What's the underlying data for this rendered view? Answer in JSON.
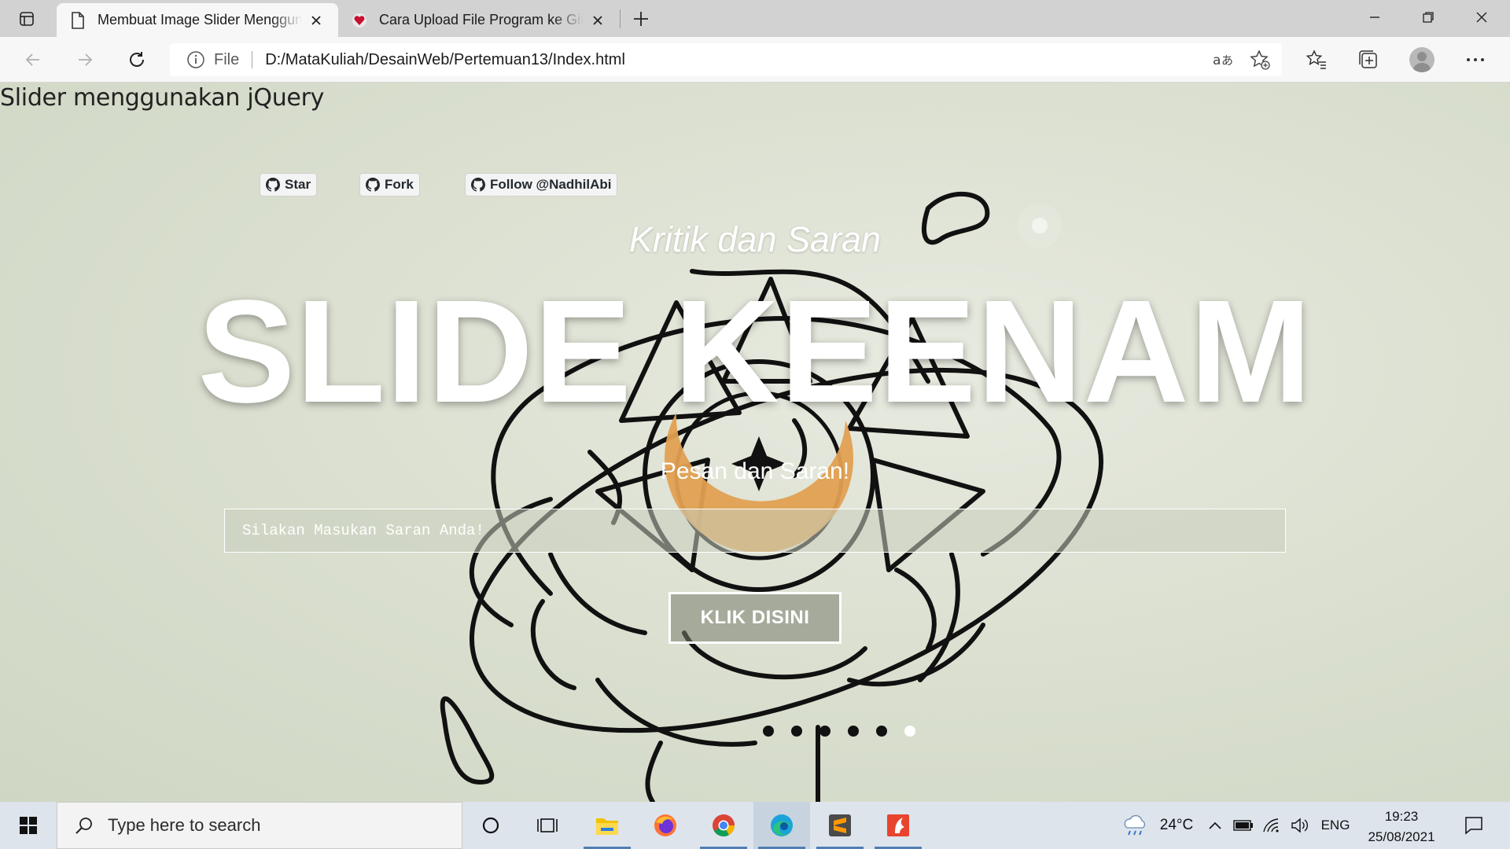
{
  "browser": {
    "tabs": [
      {
        "title": "Membuat Image Slider Menggunakan jQuery",
        "active": true
      },
      {
        "title": "Cara Upload File Program ke GitHub",
        "active": false
      }
    ],
    "address": {
      "scheme_label": "File",
      "url": "D:/MataKuliah/DesainWeb/Pertemuan13/Index.html"
    },
    "icons": [
      "tab-actions-icon",
      "page-icon",
      "close-icon",
      "new-tab-icon",
      "minimize-icon",
      "restore-icon",
      "window-close-icon",
      "back-icon",
      "forward-icon",
      "refresh-icon",
      "info-icon",
      "read-aloud-icon",
      "add-favorite-icon",
      "favorites-icon",
      "collections-icon",
      "profile-icon",
      "more-icon"
    ]
  },
  "page": {
    "heading": "Slider menggunakan jQuery",
    "github_buttons": [
      {
        "label": "Star"
      },
      {
        "label": "Fork"
      },
      {
        "label": "Follow @NadhilAbi"
      }
    ],
    "slide": {
      "subtitle": "Kritik dan Saran",
      "title": "SLIDE KEENAM",
      "label": "Pesan dan Saran!",
      "input_placeholder": "Silakan Masukan Saran Anda!",
      "button_label": "KLIK DISINI",
      "total_slides": 6,
      "active_slide": 6
    }
  },
  "taskbar": {
    "search_placeholder": "Type here to search",
    "apps": [
      "cortana-icon",
      "task-view-icon",
      "file-explorer-icon",
      "firefox-icon",
      "chrome-icon",
      "edge-icon",
      "sublime-text-icon",
      "foxit-reader-icon"
    ],
    "weather": "24°C",
    "language": "ENG",
    "time": "19:23",
    "date": "25/08/2021"
  },
  "colors": {
    "accent": "#4f7fb3",
    "page_bg": "#dfe3d6",
    "tabstrip": "#d2d2d2",
    "taskbar": "#dde4ec"
  }
}
